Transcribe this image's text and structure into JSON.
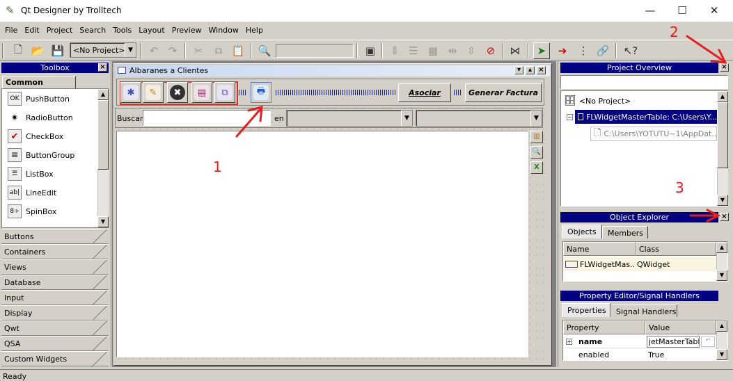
{
  "window": {
    "title": "Qt Designer by Trolltech",
    "minimize": "—",
    "maximize": "☐",
    "close": "✕"
  },
  "menu": [
    "File",
    "Edit",
    "Project",
    "Search",
    "Tools",
    "Layout",
    "Preview",
    "Window",
    "Help"
  ],
  "toolbar": {
    "project_combo": "<No Project>"
  },
  "toolbox": {
    "title": "Toolbox",
    "section": "Common Widgets",
    "items": [
      {
        "label": "PushButton",
        "icon": "OK"
      },
      {
        "label": "RadioButton",
        "icon": "◉"
      },
      {
        "label": "CheckBox",
        "icon": "✔"
      },
      {
        "label": "ButtonGroup",
        "icon": "▤"
      },
      {
        "label": "ListBox",
        "icon": "☰"
      },
      {
        "label": "LineEdit",
        "icon": "ab|"
      },
      {
        "label": "SpinBox",
        "icon": "8÷"
      }
    ],
    "categories": [
      "Buttons",
      "Containers",
      "Views",
      "Database",
      "Input",
      "Display",
      "Qwt",
      "QSA",
      "Custom Widgets"
    ]
  },
  "form": {
    "title": "Albaranes a Clientes",
    "asociar": "Asociar",
    "generar": "Generar Factura",
    "buscar": "Buscar",
    "en": "en"
  },
  "project_overview": {
    "title": "Project Overview",
    "root": "<No Project>",
    "child": "FLWidgetMasterTable: C:\\Users\\Y...",
    "file": "C:\\Users\\YOTUTU~1\\AppDat..."
  },
  "object_explorer": {
    "title": "Object Explorer",
    "tabs": [
      "Objects",
      "Members"
    ],
    "columns": [
      "Name",
      "Class"
    ],
    "row": {
      "name": "FLWidgetMas...",
      "class": "QWidget"
    }
  },
  "property_editor": {
    "title": "Property Editor/Signal Handlers",
    "tabs": [
      "Properties",
      "Signal Handlers"
    ],
    "columns": [
      "Property",
      "Value"
    ],
    "rows": [
      {
        "property": "name",
        "value": "jetMasterTable"
      },
      {
        "property": "enabled",
        "value": "True"
      }
    ]
  },
  "status": "Ready",
  "annotations": [
    "1",
    "2",
    "3"
  ],
  "colors": {
    "navy": "#000080",
    "annotation": "#e02020",
    "face": "#d4d0c8"
  }
}
